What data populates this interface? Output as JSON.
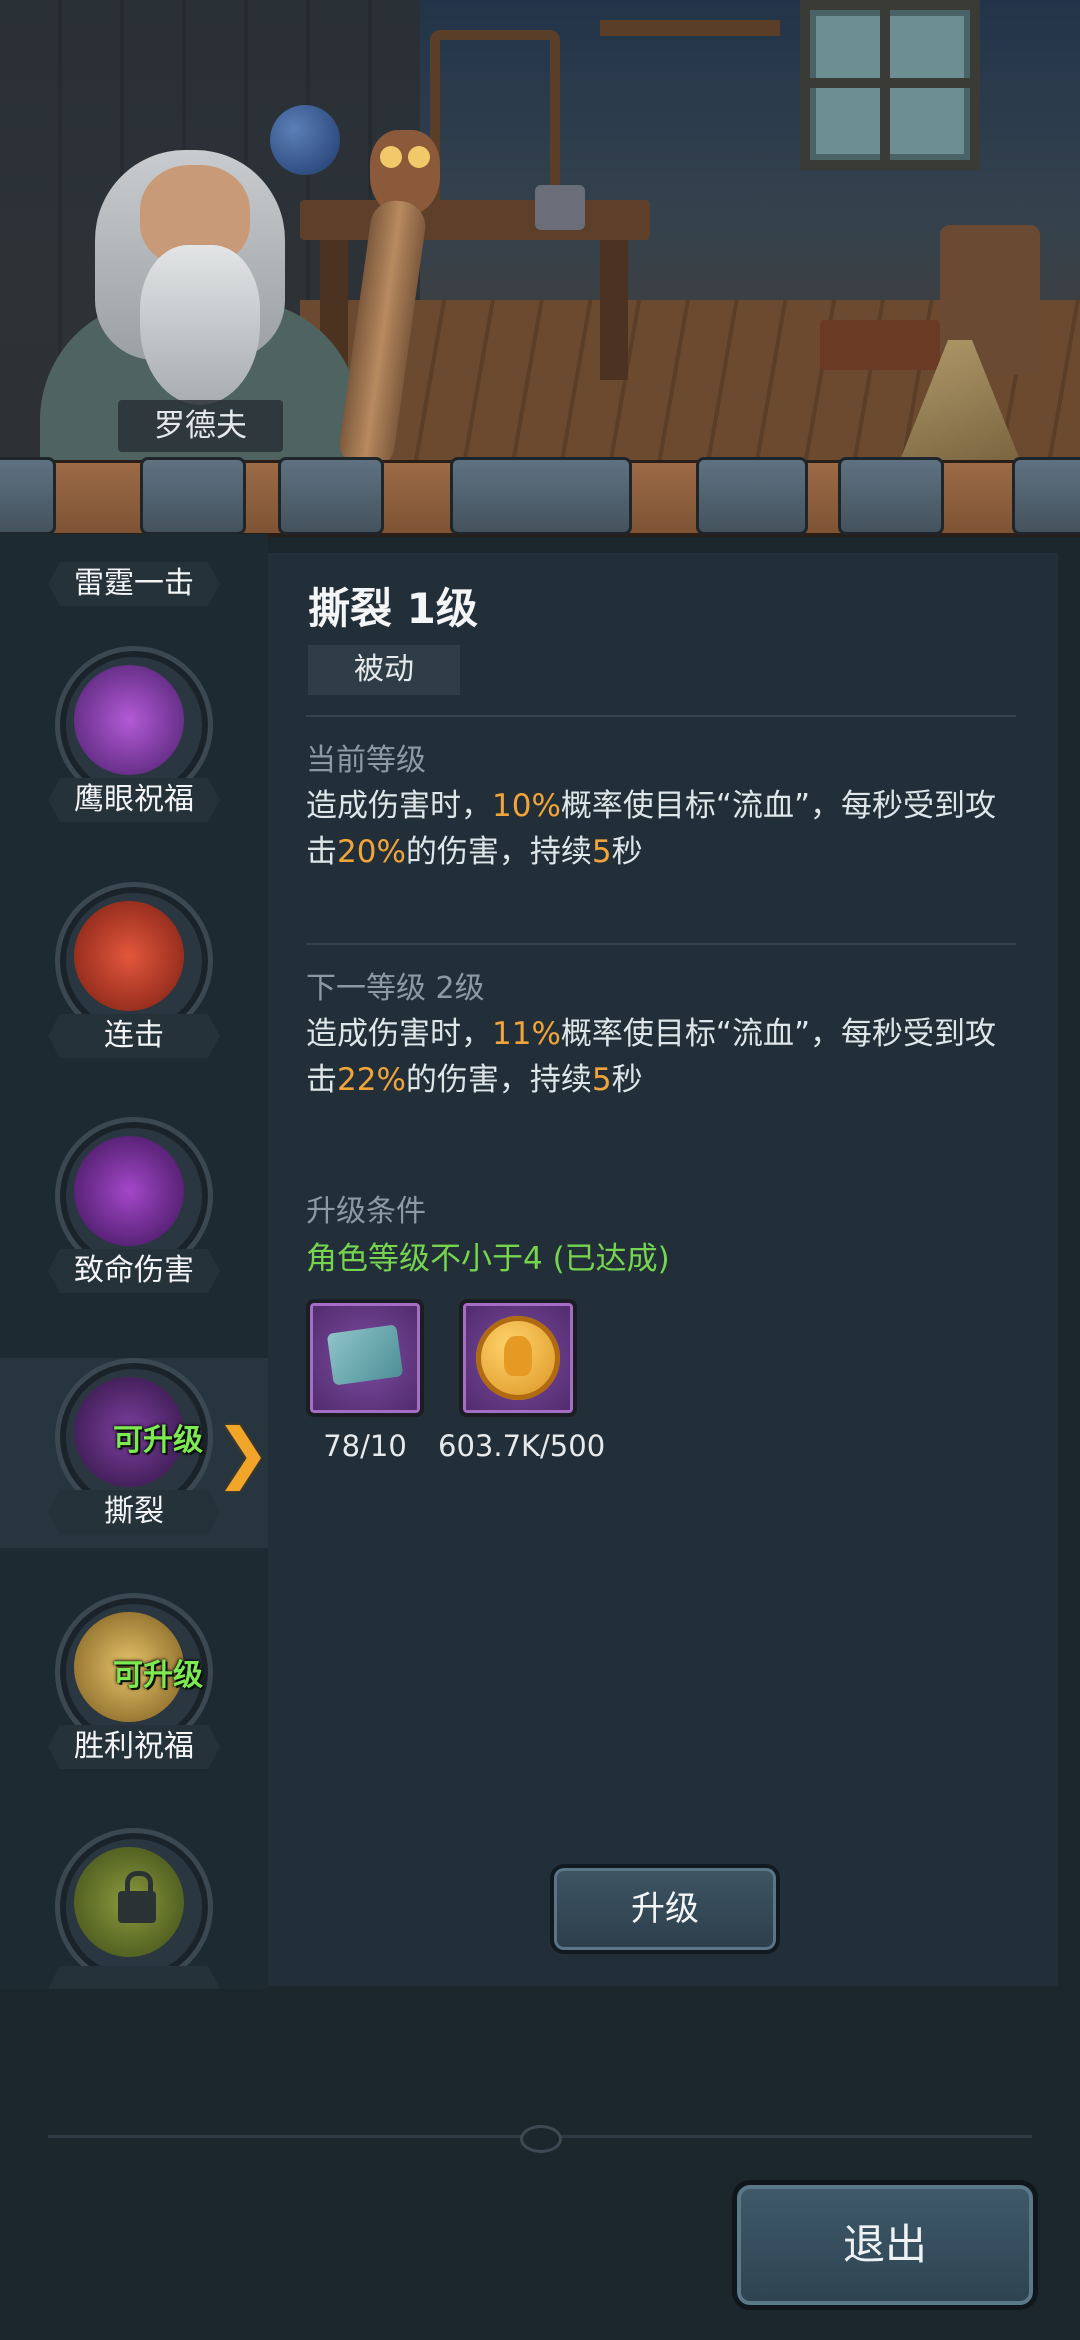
{
  "npc": {
    "name": "罗德夫"
  },
  "skills": [
    {
      "name": "雷霆一击",
      "badge": ""
    },
    {
      "name": "鹰眼祝福",
      "badge": ""
    },
    {
      "name": "连击",
      "badge": ""
    },
    {
      "name": "致命伤害",
      "badge": ""
    },
    {
      "name": "撕裂",
      "badge": "可升级"
    },
    {
      "name": "胜利祝福",
      "badge": "可升级"
    },
    {
      "name": "",
      "badge": ""
    }
  ],
  "detail": {
    "title": "撕裂 1级",
    "type": "被动",
    "current": {
      "heading": "当前等级",
      "p1": "造成伤害时，",
      "v1": "10%",
      "p2": "概率使目标“流血”，每秒受到攻击",
      "v2": "20%",
      "p3": "的伤害，持续",
      "v3": "5",
      "p4": "秒"
    },
    "next": {
      "heading": "下一等级 2级",
      "p1": "造成伤害时，",
      "v1": "11%",
      "p2": "概率使目标“流血”，每秒受到攻击",
      "v2": "22%",
      "p3": "的伤害，持续",
      "v3": "5",
      "p4": "秒"
    },
    "requirements": {
      "heading": "升级条件",
      "condition": "角色等级不小于4 (已达成)",
      "items": [
        {
          "icon": "scroll-map-icon",
          "qty": "78/10"
        },
        {
          "icon": "gold-coin-icon",
          "qty": "603.7K/500"
        }
      ]
    },
    "upgrade_label": "升级"
  },
  "exit_label": "退出",
  "colors": {
    "highlight": "#f0a43a",
    "condition": "#76d44f",
    "selected_arrow": "#f1a62a"
  }
}
